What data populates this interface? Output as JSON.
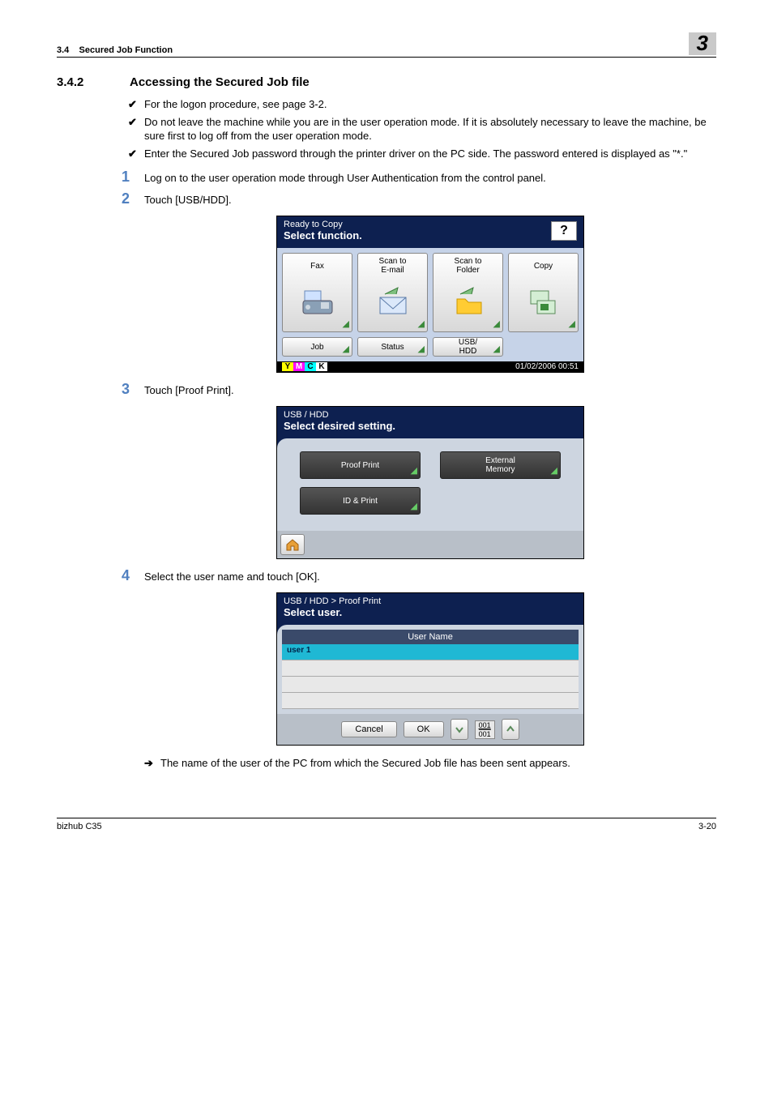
{
  "header": {
    "section_num": "3.4",
    "section_title": "Secured Job Function",
    "chapter": "3"
  },
  "title": {
    "num": "3.4.2",
    "text": "Accessing the Secured Job file"
  },
  "bullets": [
    "For the logon procedure, see page 3-2.",
    "Do not leave the machine while you are in the user operation mode. If it is absolutely necessary to leave the machine, be sure first to log off from the user operation mode.",
    "Enter the Secured Job password through the printer driver on the PC side. The password entered is displayed as \"*.\""
  ],
  "steps": {
    "s1": {
      "n": "1",
      "t": "Log on to the user operation mode through User Authentication from the control panel."
    },
    "s2": {
      "n": "2",
      "t": "Touch [USB/HDD]."
    },
    "s3": {
      "n": "3",
      "t": "Touch [Proof Print]."
    },
    "s4": {
      "n": "4",
      "t": "Select the user name and touch [OK]."
    }
  },
  "note_arrow": "The name of the user of the PC from which the Secured Job file has been sent appears.",
  "scr1": {
    "head1": "Ready to Copy",
    "head2": "Select function.",
    "tiles": {
      "fax": "Fax",
      "email": "Scan to\nE-mail",
      "folder": "Scan to\nFolder",
      "copy": "Copy"
    },
    "small": {
      "job": "Job",
      "status": "Status",
      "usb": "USB/\nHDD"
    },
    "ymck": {
      "y": "Y",
      "m": "M",
      "c": "C",
      "k": "K"
    },
    "timestamp": "01/02/2006  00:51"
  },
  "scr2": {
    "head1": "USB / HDD",
    "head2": "Select desired setting.",
    "btns": {
      "proof": "Proof Print",
      "ext": "External\nMemory",
      "idp": "ID & Print"
    }
  },
  "scr3": {
    "head1": "USB / HDD > Proof Print",
    "head2": "Select user.",
    "col": "User Name",
    "row1": "user 1",
    "cancel": "Cancel",
    "ok": "OK",
    "page_top": "001",
    "page_bot": "001"
  },
  "footer": {
    "left": "bizhub C35",
    "right": "3-20"
  },
  "help_glyph": "?"
}
